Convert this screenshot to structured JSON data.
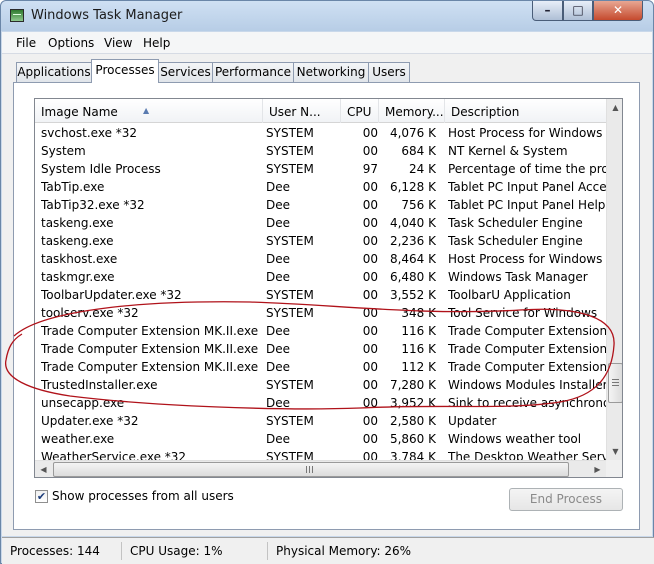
{
  "window": {
    "title": "Windows Task Manager"
  },
  "menu": [
    "File",
    "Options",
    "View",
    "Help"
  ],
  "tabs": [
    "Applications",
    "Processes",
    "Services",
    "Performance",
    "Networking",
    "Users"
  ],
  "active_tab": "Processes",
  "columns": [
    "Image Name",
    "User N...",
    "CPU",
    "Memory...",
    "Description"
  ],
  "rows": [
    {
      "name": "svchost.exe *32",
      "user": "SYSTEM",
      "cpu": "00",
      "memory": "4,076 K",
      "description": "Host Process for Windows S"
    },
    {
      "name": "System",
      "user": "SYSTEM",
      "cpu": "00",
      "memory": "684 K",
      "description": "NT Kernel & System"
    },
    {
      "name": "System Idle Process",
      "user": "SYSTEM",
      "cpu": "97",
      "memory": "24 K",
      "description": "Percentage of time the proc"
    },
    {
      "name": "TabTip.exe",
      "user": "Dee",
      "cpu": "00",
      "memory": "6,128 K",
      "description": "Tablet PC Input Panel Acces"
    },
    {
      "name": "TabTip32.exe *32",
      "user": "Dee",
      "cpu": "00",
      "memory": "756 K",
      "description": "Tablet PC Input Panel Helpe"
    },
    {
      "name": "taskeng.exe",
      "user": "Dee",
      "cpu": "00",
      "memory": "4,040 K",
      "description": "Task Scheduler Engine"
    },
    {
      "name": "taskeng.exe",
      "user": "SYSTEM",
      "cpu": "00",
      "memory": "2,236 K",
      "description": "Task Scheduler Engine"
    },
    {
      "name": "taskhost.exe",
      "user": "Dee",
      "cpu": "00",
      "memory": "8,464 K",
      "description": "Host Process for Windows T"
    },
    {
      "name": "taskmgr.exe",
      "user": "Dee",
      "cpu": "00",
      "memory": "6,480 K",
      "description": "Windows Task Manager"
    },
    {
      "name": "ToolbarUpdater.exe *32",
      "user": "SYSTEM",
      "cpu": "00",
      "memory": "3,552 K",
      "description": "ToolbarU Application"
    },
    {
      "name": "toolserv.exe *32",
      "user": "SYSTEM",
      "cpu": "00",
      "memory": "348 K",
      "description": "Tool Service for Windows"
    },
    {
      "name": "Trade Computer Extension MK.II.exe...",
      "user": "Dee",
      "cpu": "00",
      "memory": "116 K",
      "description": "Trade Computer Extension M"
    },
    {
      "name": "Trade Computer Extension MK.II.exe...",
      "user": "Dee",
      "cpu": "00",
      "memory": "116 K",
      "description": "Trade Computer Extension M"
    },
    {
      "name": "Trade Computer Extension MK.II.exe...",
      "user": "Dee",
      "cpu": "00",
      "memory": "112 K",
      "description": "Trade Computer Extension M"
    },
    {
      "name": "TrustedInstaller.exe",
      "user": "SYSTEM",
      "cpu": "00",
      "memory": "7,280 K",
      "description": "Windows Modules Installer"
    },
    {
      "name": "unsecapp.exe",
      "user": "Dee",
      "cpu": "00",
      "memory": "3,952 K",
      "description": "Sink to receive asynchronou"
    },
    {
      "name": "Updater.exe *32",
      "user": "SYSTEM",
      "cpu": "00",
      "memory": "2,580 K",
      "description": "Updater"
    },
    {
      "name": "weather.exe",
      "user": "Dee",
      "cpu": "00",
      "memory": "5,860 K",
      "description": "Windows weather tool"
    },
    {
      "name": "WeatherService.exe *32",
      "user": "SYSTEM",
      "cpu": "00",
      "memory": "3,784 K",
      "description": "The Desktop Weather Servic"
    }
  ],
  "show_all_users": {
    "label": "Show processes from all users",
    "checked": true
  },
  "end_process_label": "End Process",
  "status": {
    "processes": "Processes: 144",
    "cpu": "CPU Usage: 1%",
    "memory": "Physical Memory: 26%"
  },
  "annotation_color": "#b0121a"
}
